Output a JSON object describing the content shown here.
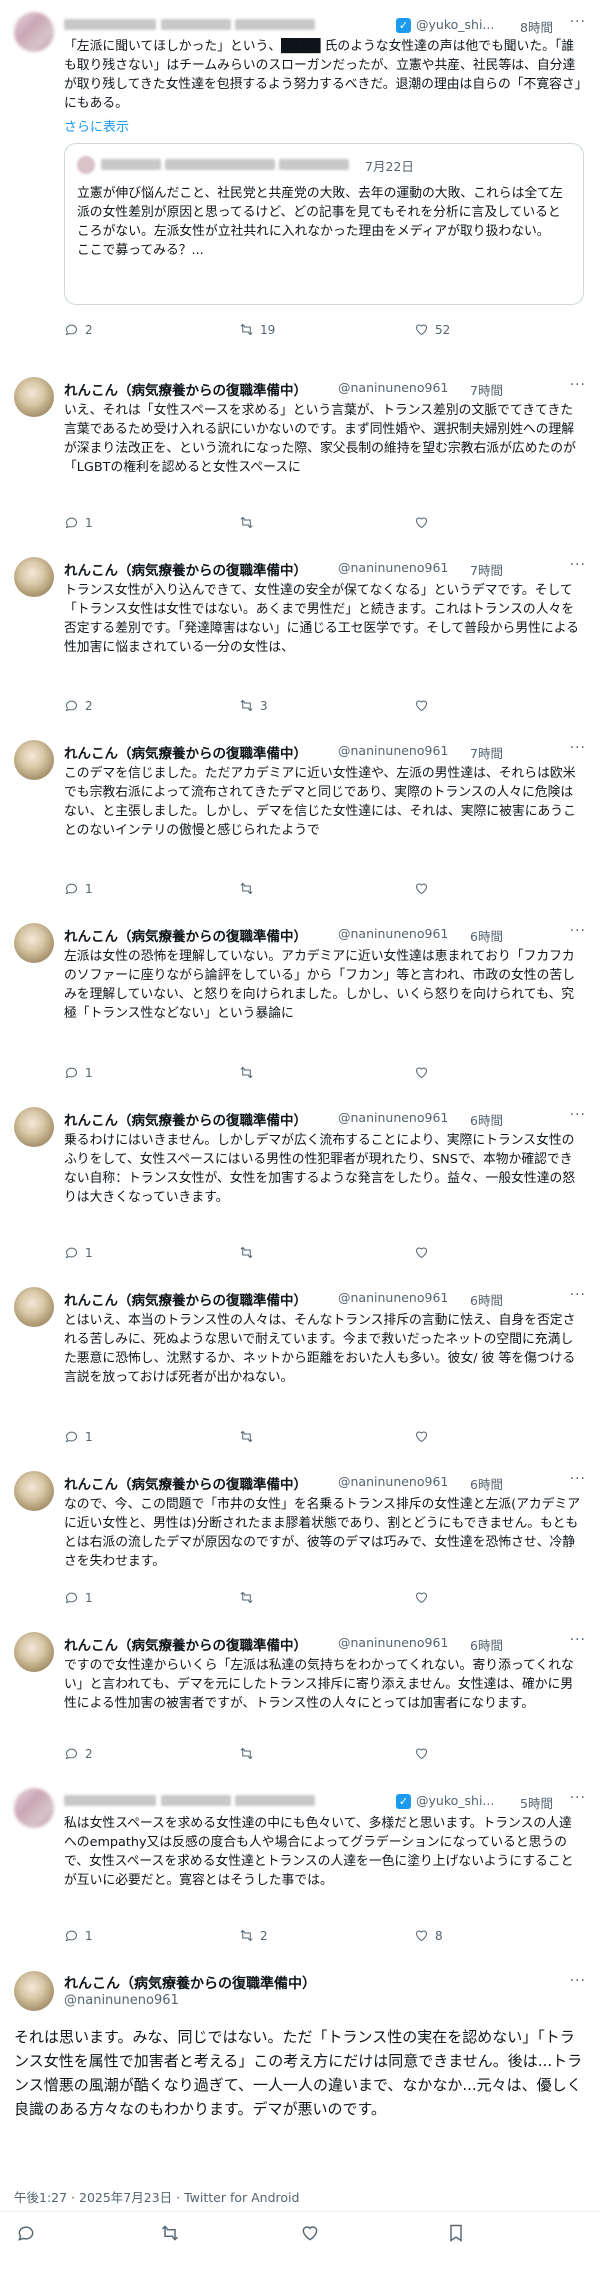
{
  "header_tweet": {
    "handle": "@yuko_shi...",
    "time": "8時間",
    "body": "「左派に聞いてほしかった」という、████ 氏のような女性達の声は他でも聞いた。「誰も取り残さない」はチームみらいのスローガンだったが、立憲や共産、社民等は、自分達が取り残してきた女性達を包摂するよう努力するべきだ。退潮の理由は自らの「不寛容さ」にもある。",
    "show_more": "さらに表示",
    "quote": {
      "date": "7月22日",
      "body": "立憲が伸び悩んだこと、社民党と共産党の大敗、去年の運動の大敗、これらは全て左派の女性差別が原因と思ってるけど、どの記事を見てもそれを分析に言及しているところがない。左派女性が立社共れに入れなかった理由をメディアが取り扱わない。\nここで募ってみる？..."
    },
    "replies": "2",
    "reposts": "19",
    "likes": "52"
  },
  "replies": [
    {
      "name": "れんこん（病気療養からの復職準備中）",
      "handle": "@naninuneno961",
      "time": "7時間",
      "body": "いえ、それは「女性スペースを求める」という言葉が、トランス差別の文脈でてきてきた言葉であるため受け入れる訳にいかないのです。まず同性婚や、選択制夫婦別姓への理解が深まり法改正を、という流れになった際、家父長制の維持を望む宗教右派が広めたのが「LGBTの権利を認めると女性スペースに",
      "replies": "1",
      "reposts": "",
      "likes": ""
    },
    {
      "name": "れんこん（病気療養からの復職準備中）",
      "handle": "@naninuneno961",
      "time": "7時間",
      "body": "トランス女性が入り込んできて、女性達の安全が保てなくなる」というデマです。そして「トランス女性は女性ではない。あくまで男性だ」と続きます。これはトランスの人々を否定する差別です。「発達障害はない」に通じる工セ医学です。そして普段から男性による性加害に悩まされている一分の女性は、",
      "replies": "2",
      "reposts": "3",
      "likes": ""
    },
    {
      "name": "れんこん（病気療養からの復職準備中）",
      "handle": "@naninuneno961",
      "time": "7時間",
      "body": "このデマを信じました。ただアカデミアに近い女性達や、左派の男性達は、それらは欧米でも宗教右派によって流布されてきたデマと同じであり、実際のトランスの人々に危険はない、と主張しました。しかし、デマを信じた女性達には、それは、実際に被害にあうことのないインテリの傲慢と感じられたようで",
      "replies": "1",
      "reposts": "",
      "likes": ""
    },
    {
      "name": "れんこん（病気療養からの復職準備中）",
      "handle": "@naninuneno961",
      "time": "6時間",
      "body": "左派は女性の恐怖を理解していない。アカデミアに近い女性達は恵まれており「フカフカのソファーに座りながら論評をしている」から「フカン」等と言われ、市政の女性の苦しみを理解していない、と怒りを向けられました。しかし、いくら怒りを向けられても、究極「トランス性などない」という暴論に",
      "replies": "1",
      "reposts": "",
      "likes": ""
    },
    {
      "name": "れんこん（病気療養からの復職準備中）",
      "handle": "@naninuneno961",
      "time": "6時間",
      "body": "乗るわけにはいきません。しかしデマが広く流布することにより、実際にトランス女性のふりをして、女性スペースにはいる男性の性犯罪者が現れたり、SNSで、本物か確認できない自称：トランス女性が、女性を加害するような発言をしたり。益々、一般女性達の怒りは大きくなっていきます。",
      "replies": "1",
      "reposts": "",
      "likes": ""
    },
    {
      "name": "れんこん（病気療養からの復職準備中）",
      "handle": "@naninuneno961",
      "time": "6時間",
      "body": "とはいえ、本当のトランス性の人々は、そんなトランス排斥の言動に怯え、自身を否定される苦しみに、死ぬような思いで耐えています。今まで救いだったネットの空間に充満した悪意に恐怖し、沈黙するか、ネットから距離をおいた人も多い。彼女/ 彼 等を傷つける言説を放っておけば死者が出かねない。",
      "replies": "1",
      "reposts": "",
      "likes": ""
    },
    {
      "name": "れんこん（病気療養からの復職準備中）",
      "handle": "@naninuneno961",
      "time": "6時間",
      "body": "なので、今、この問題で「市井の女性」を名乗るトランス排斥の女性達と左派(アカデミアに近い女性と、男性は)分断されたまま膠着状態であり、割とどうにもできません。もともとは右派の流したデマが原因なのですが、彼等のデマは巧みで、女性達を恐怖させ、冷静さを失わせます。",
      "replies": "1",
      "reposts": "",
      "likes": ""
    },
    {
      "name": "れんこん（病気療養からの復職準備中）",
      "handle": "@naninuneno961",
      "time": "6時間",
      "body": "ですので女性達からいくら「左派は私達の気持ちをわかってくれない。寄り添ってくれない」と言われても、デマを元にしたトランス排斥に寄り添えません。女性達は、確かに男性による性加害の被害者ですが、トランス性の人々にとっては加害者になります。",
      "replies": "2",
      "reposts": "",
      "likes": ""
    }
  ],
  "reply_yuko": {
    "handle": "@yuko_shi...",
    "time": "5時間",
    "body": "私は女性スペースを求める女性達の中にも色々いて、多様だと思います。トランスの人達へのempathy又は反感の度合も人や場合によってグラデーションになっていると思うので、女性スペースを求める女性達とトランスの人達を一色に塗り上げないようにすることが互いに必要だと。寛容とはそうした事では。",
    "replies": "1",
    "reposts": "2",
    "likes": "8"
  },
  "main_tweet": {
    "name": "れんこん（病気療養からの復職準備中）",
    "handle": "@naninuneno961",
    "body": "それは思います。みな、同じではない。ただ「トランス性の実在を認めない」「トランス女性を属性で加害者と考える」この考え方にだけは同意できません。後は...トランス憎悪の風潮が酷くなり過ぎて、一人一人の違いまで、なかなか...元々は、優しく良識のある方々なのもわかります。デマが悪いのです。",
    "meta": "午後1:27 · 2025年7月23日 · Twitter for Android"
  },
  "icons": [
    "reply-icon",
    "repost-icon",
    "like-icon",
    "bookmark-icon",
    "more-icon",
    "verified-icon"
  ],
  "colors": {
    "accent": "#1d9bf0",
    "muted": "#536471",
    "border": "#cfd9de"
  }
}
